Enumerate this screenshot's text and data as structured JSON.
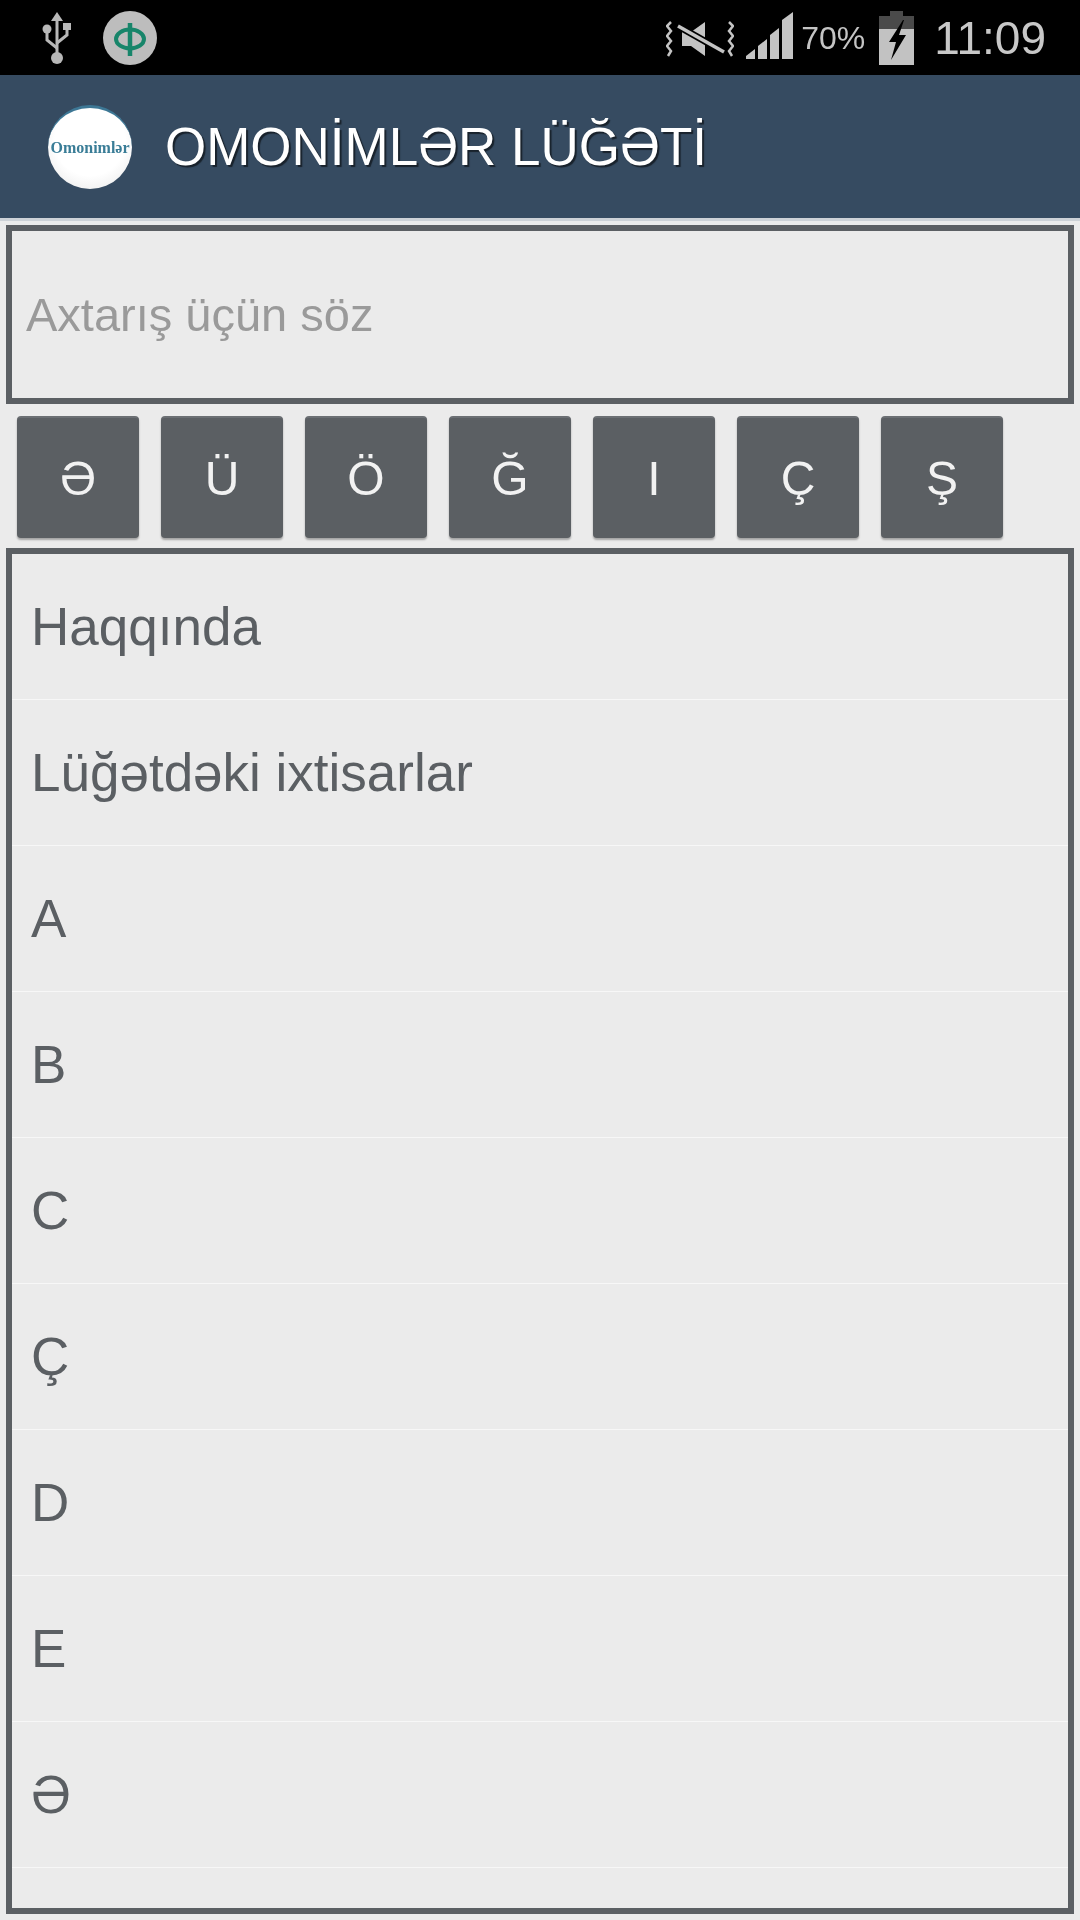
{
  "status_bar": {
    "battery_percent": "70%",
    "time": "11:09"
  },
  "app_bar": {
    "logo_text": "Omonimlər",
    "title": "OMONİMLƏR LÜĞƏTİ"
  },
  "search": {
    "placeholder": "Axtarış üçün söz"
  },
  "letter_keys": [
    "Ə",
    "Ü",
    "Ö",
    "Ğ",
    "I",
    "Ç",
    "Ş"
  ],
  "list": {
    "items": [
      "Haqqında",
      "Lüğətdəki ixtisarlar",
      "A",
      "B",
      "C",
      "Ç",
      "D",
      "E",
      "Ə"
    ]
  }
}
